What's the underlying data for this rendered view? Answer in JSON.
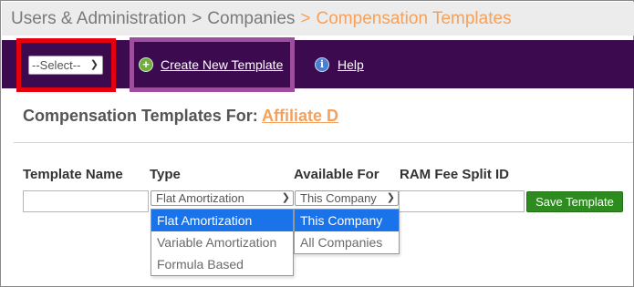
{
  "breadcrumb": {
    "items": [
      "Users & Administration",
      "Companies"
    ],
    "separator": ">",
    "current": "Compensation Templates"
  },
  "toolbar": {
    "select_value": "--Select--",
    "select_icon": "chevron-down-icon",
    "create_label": "Create New Template",
    "create_icon": "plus-circle-icon",
    "help_label": "Help",
    "help_icon": "info-icon"
  },
  "section": {
    "title_prefix": "Compensation Templates For:",
    "affiliate": "Affiliate D"
  },
  "form": {
    "columns": [
      "Template Name",
      "Type",
      "Available For",
      "RAM Fee Split ID"
    ],
    "template_name_value": "",
    "type_value": "Flat Amortization",
    "available_for_value": "This Company",
    "ram_fee_split_value": "",
    "save_label": "Save Template"
  },
  "type_menu": {
    "options": [
      "Flat Amortization",
      "Variable Amortization",
      "Formula Based"
    ],
    "selected": "Flat Amortization"
  },
  "available_menu": {
    "options": [
      "This Company",
      "All Companies"
    ],
    "selected": "This Company"
  },
  "colors": {
    "toolbar_bg": "#3c0a4f",
    "accent_orange": "#f5a15c",
    "save_green": "#2e8b1f",
    "highlight_red": "#e3000f",
    "highlight_purple": "#9e4e9e",
    "menu_selected": "#1a73e8"
  }
}
